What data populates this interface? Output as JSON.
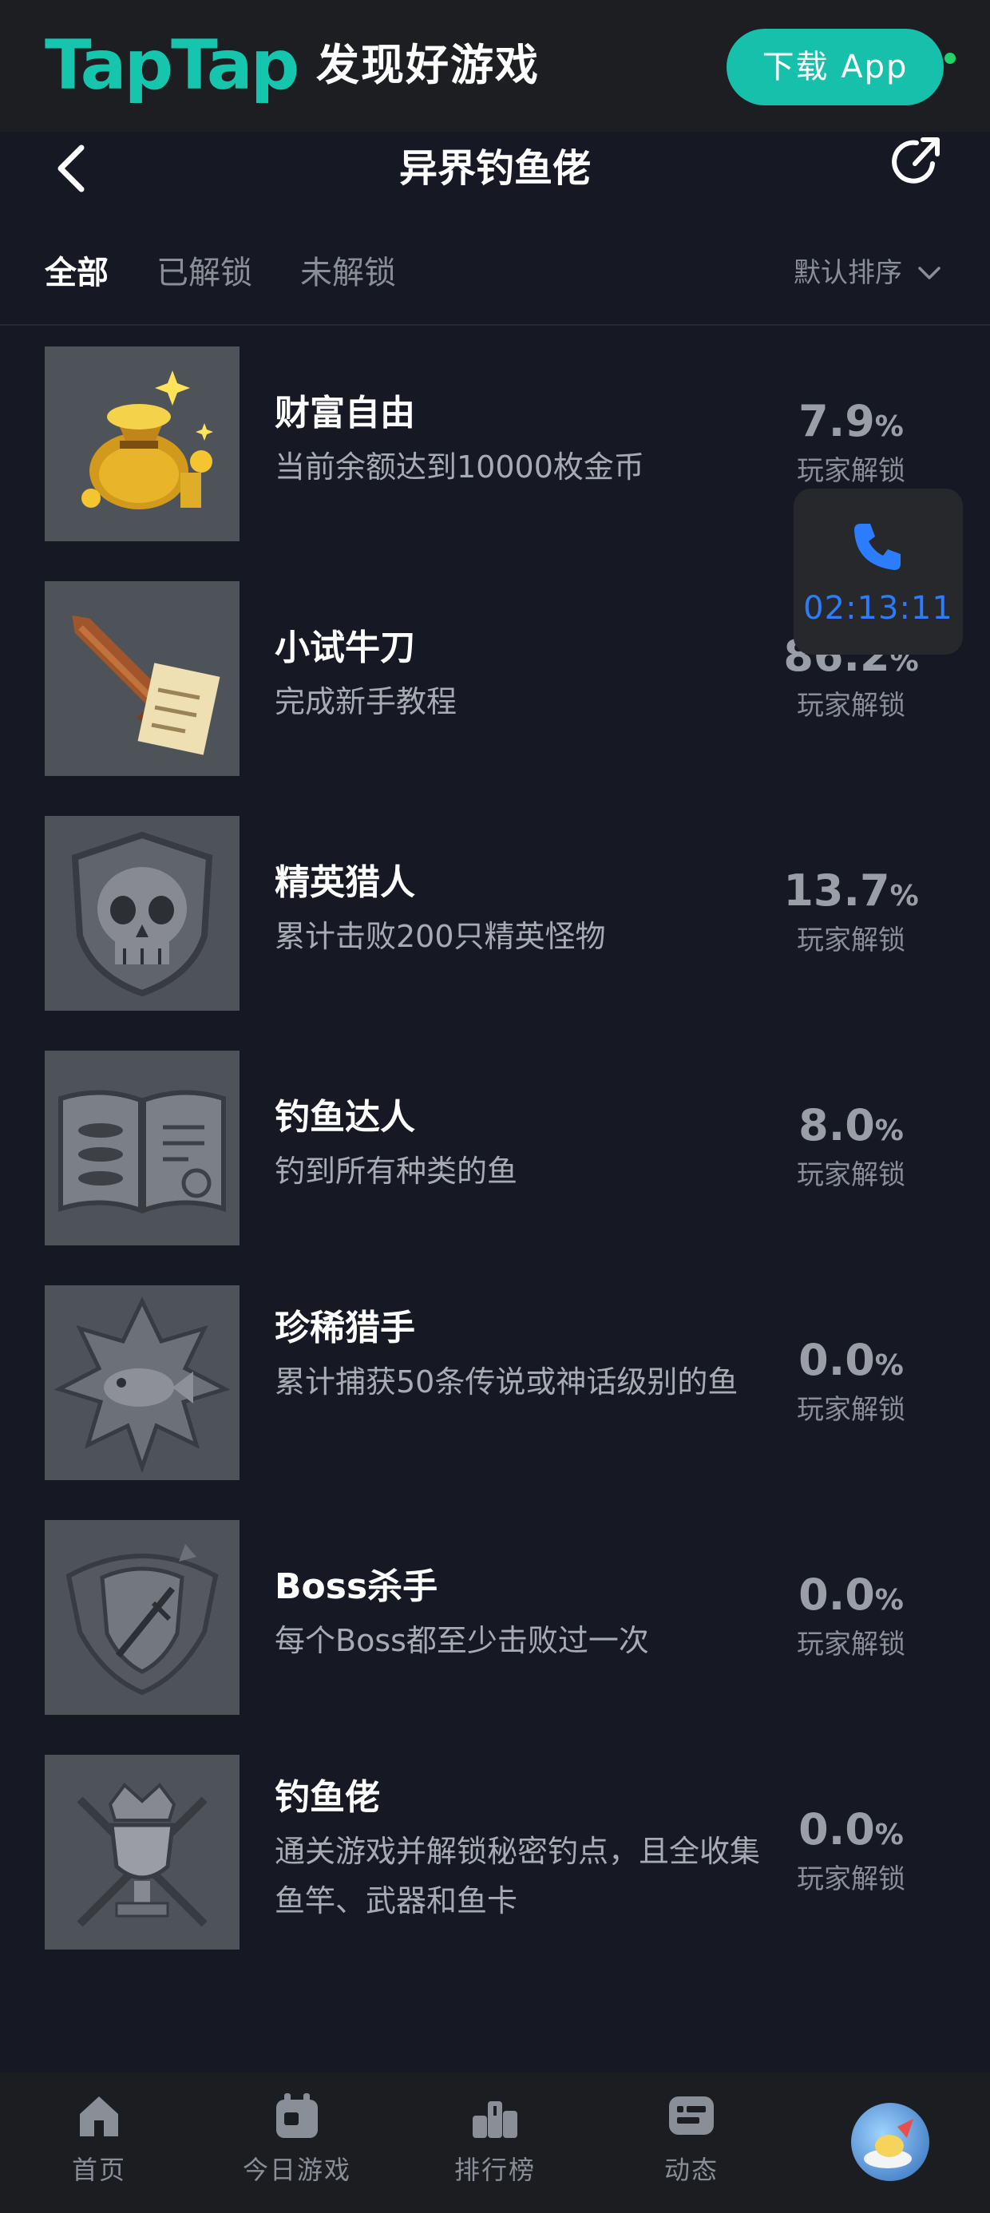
{
  "promo": {
    "logo_text": "TapTap",
    "slogan": "发现好游戏",
    "download_label": "下载 App",
    "accent_color": "#16c0aa"
  },
  "header": {
    "title": "异界钓鱼佬"
  },
  "tabs": [
    {
      "label": "全部",
      "active": true
    },
    {
      "label": "已解锁",
      "active": false
    },
    {
      "label": "未解锁",
      "active": false
    }
  ],
  "sort": {
    "label": "默认排序"
  },
  "achievements": [
    {
      "name": "财富自由",
      "desc": "当前余额达到10000枚金币",
      "pct": "7.9",
      "unit": "%",
      "label": "玩家解锁",
      "icon": "gold-bag-icon"
    },
    {
      "name": "小试牛刀",
      "desc": "完成新手教程",
      "pct": "86.2",
      "unit": "%",
      "label": "玩家解锁",
      "icon": "sword-scroll-icon"
    },
    {
      "name": "精英猎人",
      "desc": "累计击败200只精英怪物",
      "pct": "13.7",
      "unit": "%",
      "label": "玩家解锁",
      "icon": "skull-shield-icon"
    },
    {
      "name": "钓鱼达人",
      "desc": "钓到所有种类的鱼",
      "pct": "8.0",
      "unit": "%",
      "label": "玩家解锁",
      "icon": "fish-book-icon"
    },
    {
      "name": "珍稀猎手",
      "desc": "累计捕获50条传说或神话级别的鱼",
      "pct": "0.0",
      "unit": "%",
      "label": "玩家解锁",
      "icon": "rare-fish-icon"
    },
    {
      "name": "Boss杀手",
      "desc": "每个Boss都至少击败过一次",
      "pct": "0.0",
      "unit": "%",
      "label": "玩家解锁",
      "icon": "boss-shield-icon"
    },
    {
      "name": "钓鱼佬",
      "desc": "通关游戏并解锁秘密钓点，且全收集鱼竿、武器和鱼卡",
      "pct": "0.0",
      "unit": "%",
      "label": "玩家解锁",
      "icon": "crown-trophy-icon"
    }
  ],
  "call_widget": {
    "timer": "02:13:11"
  },
  "bottom_nav": [
    {
      "label": "首页",
      "icon": "home-icon"
    },
    {
      "label": "今日游戏",
      "icon": "calendar-icon"
    },
    {
      "label": "排行榜",
      "icon": "ranking-icon"
    },
    {
      "label": "动态",
      "icon": "feed-icon"
    }
  ]
}
